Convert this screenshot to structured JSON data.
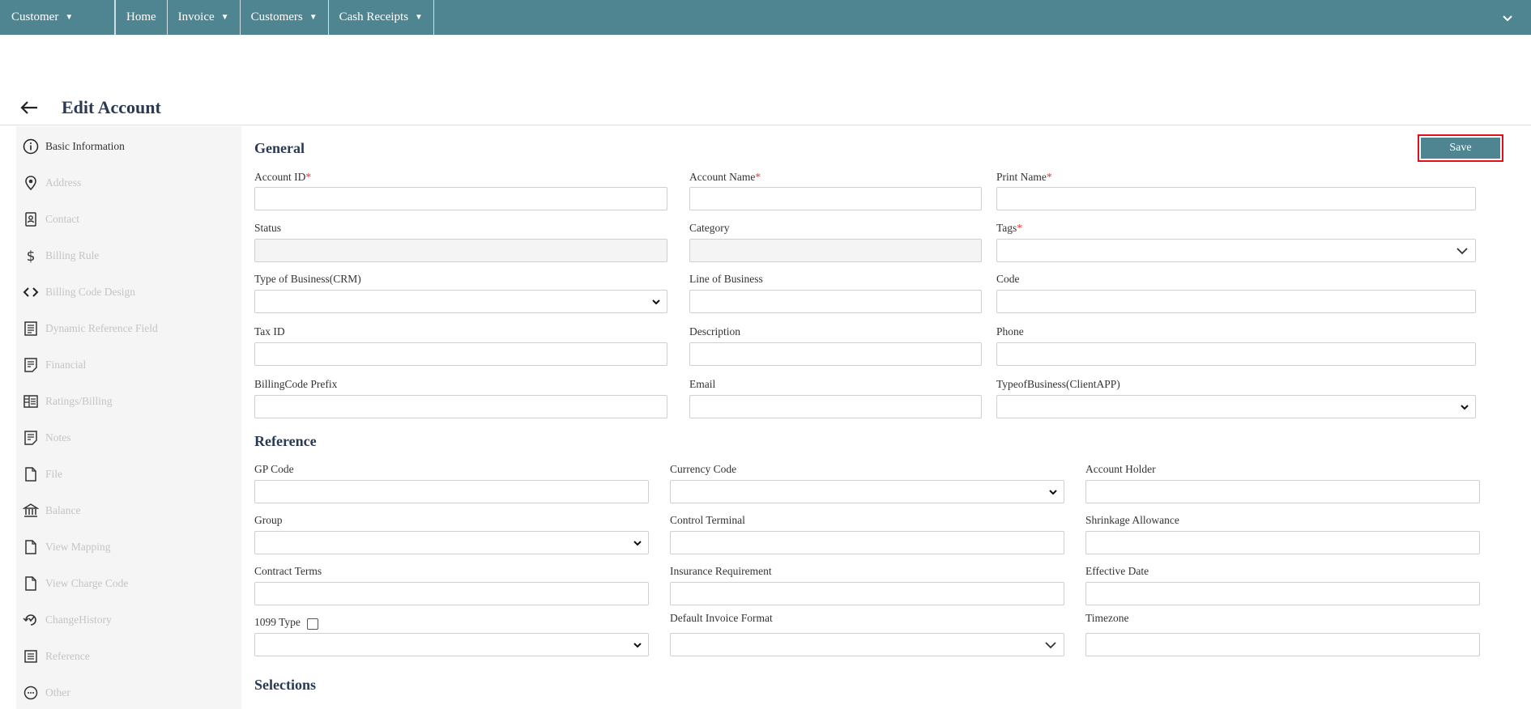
{
  "nav": {
    "module": "Customer",
    "items": [
      "Home",
      "Invoice",
      "Customers",
      "Cash Receipts"
    ]
  },
  "page": {
    "title": "Edit Account"
  },
  "sidebar": {
    "items": [
      {
        "label": "Basic Information",
        "icon": "info-icon"
      },
      {
        "label": "Address",
        "icon": "map-pin-icon"
      },
      {
        "label": "Contact",
        "icon": "contact-icon"
      },
      {
        "label": "Billing Rule",
        "icon": "dollar-icon"
      },
      {
        "label": "Billing Code Design",
        "icon": "code-icon"
      },
      {
        "label": "Dynamic Reference Field",
        "icon": "document-icon"
      },
      {
        "label": "Financial",
        "icon": "note-icon"
      },
      {
        "label": "Ratings/Billing",
        "icon": "ratings-icon"
      },
      {
        "label": "Notes",
        "icon": "note-icon"
      },
      {
        "label": "File",
        "icon": "file-icon"
      },
      {
        "label": "Balance",
        "icon": "bank-icon"
      },
      {
        "label": "View Mapping",
        "icon": "file-icon"
      },
      {
        "label": "View Charge Code",
        "icon": "file-icon"
      },
      {
        "label": "ChangeHistory",
        "icon": "history-icon"
      },
      {
        "label": "Reference",
        "icon": "reference-icon"
      },
      {
        "label": "Other",
        "icon": "chat-icon"
      }
    ]
  },
  "actions": {
    "save": "Save"
  },
  "general": {
    "title": "General",
    "account_id": "Account ID",
    "account_name": "Account Name",
    "print_name": "Print Name",
    "status": "Status",
    "category": "Category",
    "tags": "Tags",
    "type_of_business_crm": "Type of Business(CRM)",
    "line_of_business": "Line of Business",
    "code": "Code",
    "tax_id": "Tax ID",
    "description": "Description",
    "phone": "Phone",
    "billing_code_prefix": "BillingCode Prefix",
    "email": "Email",
    "type_of_business_client": "TypeofBusiness(ClientAPP)",
    "required_mark": "*"
  },
  "reference": {
    "title": "Reference",
    "gp_code": "GP Code",
    "currency_code": "Currency Code",
    "account_holder": "Account Holder",
    "group": "Group",
    "control_terminal": "Control Terminal",
    "shrinkage_allowance": "Shrinkage Allowance",
    "contract_terms": "Contract Terms",
    "insurance_requirement": "Insurance Requirement",
    "effective_date": "Effective Date",
    "type_1099": "1099 Type",
    "default_invoice_format": "Default Invoice Format",
    "timezone": "Timezone"
  },
  "selections": {
    "title": "Selections"
  }
}
